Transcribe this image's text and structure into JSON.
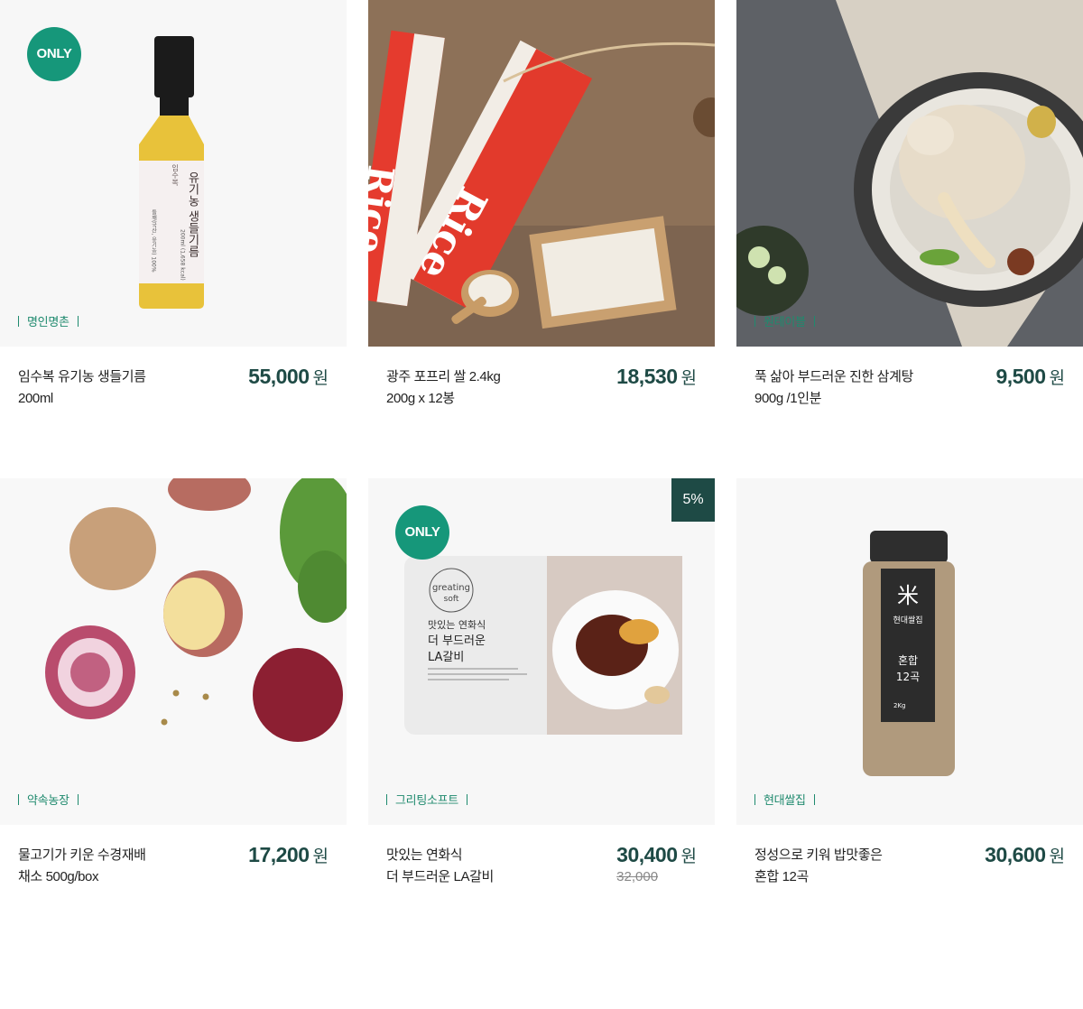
{
  "products": [
    {
      "brand": "명인명촌",
      "name_line1": "임수복 유기농 생들기름",
      "name_line2": "200ml",
      "price": "55,000",
      "currency": "원",
      "badge": "ONLY",
      "label_texts": [
        "임수복",
        "유기농 생들기름",
        "들깨(국산, 유기농) 100%",
        "200ml (1,658 kcal)"
      ]
    },
    {
      "brand": "",
      "name_line1": "광주 포프리 쌀 2.4kg",
      "name_line2": "200g x 12봉",
      "price": "18,530",
      "currency": "원",
      "label_texts": [
        "Rice",
        "Rice"
      ]
    },
    {
      "brand": "원테이블",
      "name_line1": "푹 삶아 부드러운 진한 삼계탕",
      "name_line2": "900g /1인분",
      "price": "9,500",
      "currency": "원"
    },
    {
      "brand": "약속농장",
      "name_line1": "물고기가 키운 수경재배",
      "name_line2": "채소 500g/box",
      "price": "17,200",
      "currency": "원"
    },
    {
      "brand": "그리팅소프트",
      "name_line1": "맛있는 연화식",
      "name_line2": "더 부드러운 LA갈비",
      "price": "30,400",
      "currency": "원",
      "original_price": "32,000",
      "badge": "ONLY",
      "discount": "5%",
      "label_texts": [
        "greating",
        "soft",
        "맛있는 연화식",
        "더 부드러운",
        "LA갈비"
      ]
    },
    {
      "brand": "현대쌀집",
      "name_line1": "정성으로 키워 밥맛좋은",
      "name_line2": "혼합 12곡",
      "price": "30,600",
      "currency": "원",
      "label_texts": [
        "米",
        "현대쌀집",
        "혼합",
        "12곡",
        "2Kg"
      ]
    }
  ],
  "colors": {
    "accent": "#1f8a6e",
    "badge_green": "#16977a",
    "price_dark": "#1e4a45"
  }
}
